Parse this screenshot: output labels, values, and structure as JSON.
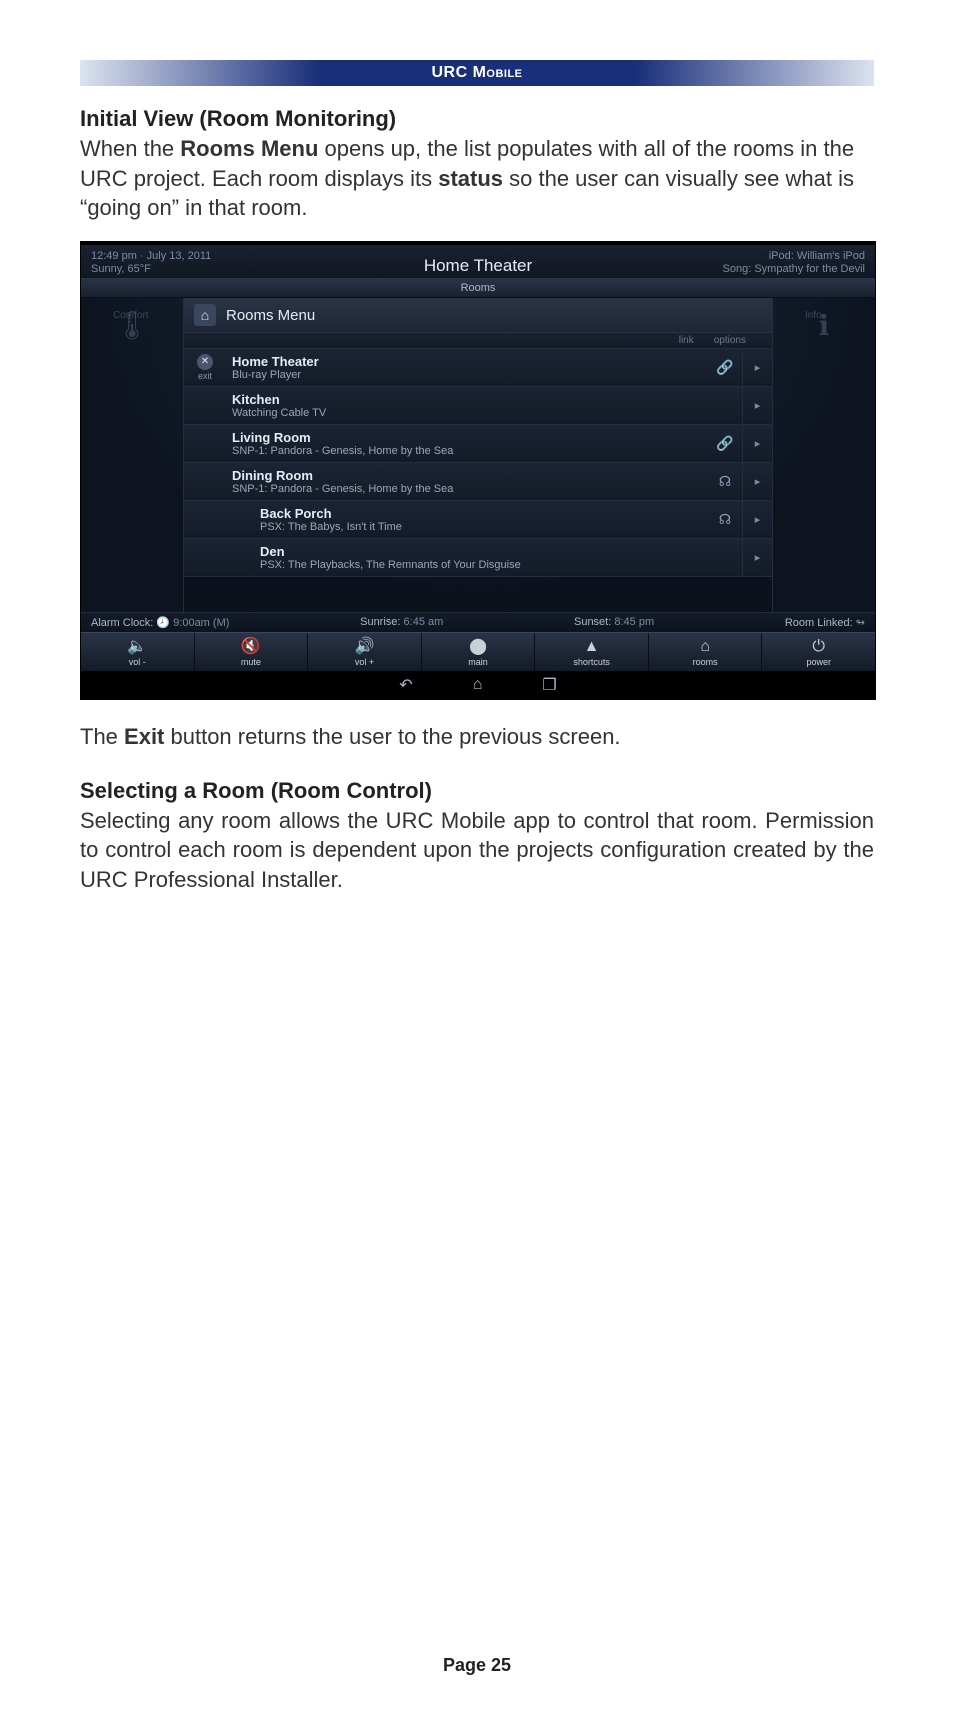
{
  "doc": {
    "header": "URC Mobile",
    "section1_title": "Initial View (Room Monitoring)",
    "p1_a": "When the ",
    "p1_b": "Rooms Menu",
    "p1_c": " opens up, the list populates with all of the rooms in the URC project. Each room displays its ",
    "p1_d": "status",
    "p1_e": " so the user can visually see what is “going on” in that room.",
    "p2_a": "The ",
    "p2_b": "Exit",
    "p2_c": " button returns the user to the previous screen.",
    "section2_title": "Selecting a Room (Room Control)",
    "p3": "Selecting any room allows the URC Mobile app to control that room. Permission to control each room is dependent upon the projects configuration created by the URC Professional Installer.",
    "page_label": "Page 25"
  },
  "shot": {
    "clock": "12:49 pm · July 13, 2011",
    "weather": "Sunny, 65°F",
    "current_room": "Home Theater",
    "subtab": "Rooms",
    "ipod_label": "iPod:",
    "ipod_value": "William's iPod",
    "song_label": "Song:",
    "song_value": "Sympathy for the Devil",
    "side_left_label": "Comfort",
    "side_right_label": "Info",
    "menu_title": "Rooms Menu",
    "col_link": "link",
    "col_options": "options",
    "exit_label": "exit",
    "rooms": [
      {
        "name": "Home Theater",
        "status": "Blu-ray Player",
        "link": true,
        "exit": true,
        "indent": false
      },
      {
        "name": "Kitchen",
        "status": "Watching Cable TV",
        "link": false,
        "exit": false,
        "indent": false
      },
      {
        "name": "Living Room",
        "status": "SNP-1: Pandora - Genesis, Home by the Sea",
        "link": true,
        "exit": false,
        "indent": false
      },
      {
        "name": "Dining Room",
        "status": "SNP-1: Pandora - Genesis, Home by the Sea",
        "link": false,
        "exit": false,
        "indent": false,
        "link_icon": "☊"
      },
      {
        "name": "Back Porch",
        "status": "PSX: The Babys, Isn't it Time",
        "link": false,
        "exit": false,
        "indent": true,
        "link_icon": "☊"
      },
      {
        "name": "Den",
        "status": "PSX: The Playbacks, The Remnants of Your Disguise",
        "link": false,
        "exit": false,
        "indent": true
      }
    ],
    "status": {
      "alarm_label": "Alarm Clock:",
      "alarm_value": "9:00am (M)",
      "sunrise_label": "Sunrise:",
      "sunrise_value": "6:45 am",
      "sunset_label": "Sunset:",
      "sunset_value": "8:45 pm",
      "linked_label": "Room Linked:"
    },
    "bottombar": [
      {
        "icon": "🔈",
        "label": "vol -"
      },
      {
        "icon": "🔇",
        "label": "mute"
      },
      {
        "icon": "🔊",
        "label": "vol +"
      },
      {
        "icon": "⬤",
        "label": "main"
      },
      {
        "icon": "▲",
        "label": "shortcuts"
      },
      {
        "icon": "⌂",
        "label": "rooms"
      },
      {
        "icon": "⏻",
        "label": "power"
      }
    ]
  }
}
